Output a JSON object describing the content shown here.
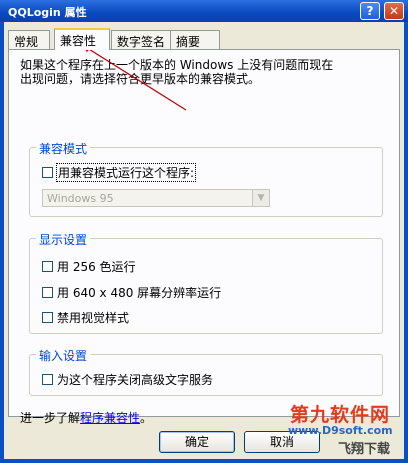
{
  "window": {
    "title": "QQLogin 属性",
    "help_label": "?",
    "close_label": "✕"
  },
  "tabs": [
    {
      "label": "常规"
    },
    {
      "label": "兼容性"
    },
    {
      "label": "数字签名"
    },
    {
      "label": "摘要"
    }
  ],
  "description": {
    "line1": "如果这个程序在上一个版本的 Windows 上没有问题而现在",
    "line2": "出现问题，请选择符合更早版本的兼容模式。"
  },
  "compat_group": {
    "title": "兼容模式",
    "checkbox_label": "用兼容模式运行这个程序:",
    "os_value": "Windows 95"
  },
  "display_group": {
    "title": "显示设置",
    "options": [
      {
        "label": "用 256 色运行"
      },
      {
        "label": "用 640 x 480 屏幕分辨率运行"
      },
      {
        "label": "禁用视觉样式"
      }
    ]
  },
  "input_group": {
    "title": "输入设置",
    "option_label": "为这个程序关闭高级文字服务"
  },
  "more_info": {
    "prefix": "进一步了解",
    "link": "程序兼容性",
    "suffix": "。"
  },
  "buttons": {
    "ok": "确定",
    "cancel": "取消"
  },
  "watermark": {
    "title": "第九软件网",
    "url": "www.D9soft.com",
    "sub": "飞翔下载"
  },
  "colors": {
    "title_bar": "#0a4fc4",
    "group_title": "#0046d5",
    "annotation_arrow": "#c00000",
    "watermark": "#e53a1f"
  }
}
